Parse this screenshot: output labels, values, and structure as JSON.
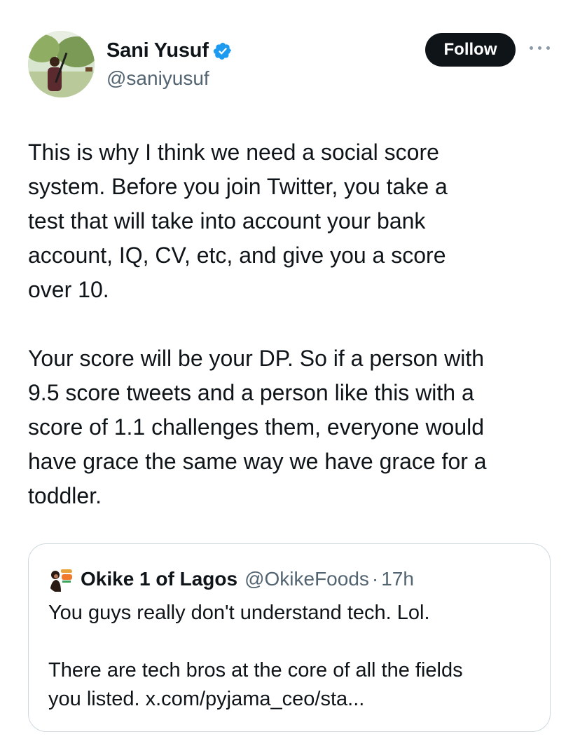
{
  "author": {
    "display_name": "Sani Yusuf",
    "handle": "@saniyusuf",
    "verified": true,
    "avatar_icon": "profile-photo-icon"
  },
  "actions": {
    "follow_label": "Follow",
    "more_icon": "more-options-icon"
  },
  "tweet": {
    "text": "This is why I think we need a social score\nsystem. Before you join Twitter, you take a\ntest that will take into account your bank\naccount, IQ, CV, etc, and give you a score\nover 10.\n\nYour score will be your DP. So if a person with\n9.5 score tweets and a person like this with a\nscore of 1.1 challenges them, everyone would\nhave grace the same way we have  grace for a\ntoddler."
  },
  "quoted_tweet": {
    "display_name": "Okike 1 of Lagos",
    "handle": "@OkikeFoods",
    "separator": "·",
    "time": "17h",
    "text": "You guys really don't understand tech. Lol.\n\nThere are tech bros at the core of all the fields\nyou listed. x.com/pyjama_ceo/sta..."
  },
  "colors": {
    "text": "#0f1419",
    "secondary": "#536471",
    "verified_blue": "#1d9bf0",
    "follow_bg": "#0f1419",
    "border": "#cfd9de"
  }
}
